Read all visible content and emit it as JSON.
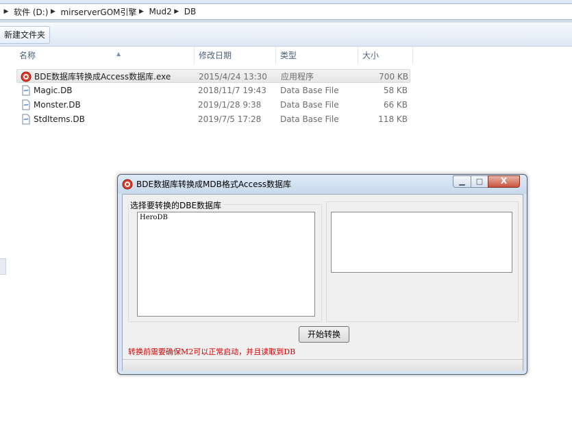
{
  "explorer": {
    "breadcrumb": [
      "软件 (D:)",
      "mirserverGOM引擎",
      "Mud2",
      "DB"
    ],
    "toolbar": {
      "new_folder_label": "新建文件夹"
    },
    "columns": {
      "name": "名称",
      "modified": "修改日期",
      "type": "类型",
      "size": "大小"
    },
    "files": [
      {
        "name": "BDE数据库转换成Access数据库.exe",
        "modified": "2015/4/24 13:30",
        "type": "应用程序",
        "size": "700 KB",
        "icon": "exe-app-icon"
      },
      {
        "name": "Magic.DB",
        "modified": "2018/11/7 19:43",
        "type": "Data Base File",
        "size": "58 KB",
        "icon": "db-file-icon"
      },
      {
        "name": "Monster.DB",
        "modified": "2019/1/28 9:38",
        "type": "Data Base File",
        "size": "66 KB",
        "icon": "db-file-icon"
      },
      {
        "name": "StdItems.DB",
        "modified": "2019/7/5 17:28",
        "type": "Data Base File",
        "size": "118 KB",
        "icon": "db-file-icon"
      }
    ]
  },
  "dialog": {
    "title": "BDE数据库转换成MDB格式Access数据库",
    "controls": {
      "minimize": "▁",
      "maximize": "□",
      "close": "X"
    },
    "group_label": "选择要转换的DBE数据库",
    "list_items": [
      "HeroDB"
    ],
    "start_button_label": "开始转换",
    "warning_text": "转换前需要确保M2可以正常启动，并且读取到DB"
  },
  "colors": {
    "warning": "#d00000",
    "window_frame": "#d6e3f1",
    "client_bg": "#f0f0f0"
  }
}
